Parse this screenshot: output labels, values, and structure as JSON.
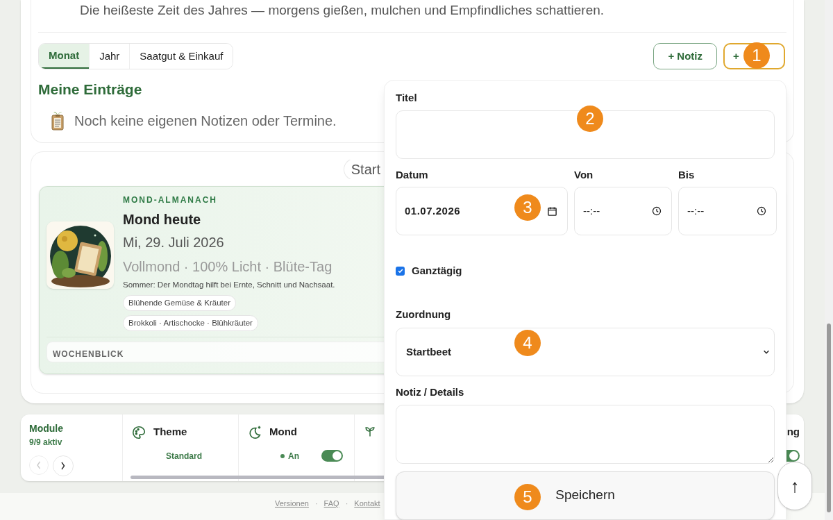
{
  "intro_text": "Die heißeste Zeit des Jahres — morgens gießen, mulchen und Empfindliches schattieren.",
  "tabs": [
    {
      "label": "Monat",
      "selected": true
    },
    {
      "label": "Jahr",
      "selected": false
    },
    {
      "label": "Saatgut & Einkauf",
      "selected": false
    }
  ],
  "action_buttons": [
    {
      "label": "+ Notiz",
      "kind": "note"
    },
    {
      "label": "+",
      "kind": "event"
    }
  ],
  "entries": {
    "heading": "Meine Einträge",
    "empty_text": "Noch keine eigenen Notizen oder Termine."
  },
  "filter_chips": [
    "Start"
  ],
  "moon_card": {
    "eyebrow": "MOND-ALMANACH",
    "title": "Mond heute",
    "date": "Mi, 29. Juli 2026",
    "phase": "Vollmond · 100% Licht · Blüte-Tag",
    "note": "Sommer: Der Mondtag hilft bei Ernte, Schnitt und Nachsaat.",
    "tags": [
      "Blühende Gemüse & Kräuter",
      "Brokkoli · Artischocke · Blühkräuter"
    ],
    "weekly_label": "WOCHENBLICK"
  },
  "modules": {
    "title": "Module",
    "count": "9/9 aktiv",
    "items": [
      {
        "title": "Theme",
        "kind": "value",
        "status": "Standard"
      },
      {
        "title": "Mond",
        "kind": "toggle",
        "status": "An",
        "on": true
      },
      {
        "kind": "covered"
      },
      {
        "title": "ng",
        "kind": "toggle",
        "on": true
      }
    ]
  },
  "footer_links": [
    "Versionen",
    "FAQ",
    "Kontakt"
  ],
  "footer_separator": "·",
  "form": {
    "title_label": "Titel",
    "date_label": "Datum",
    "date_value": "01.07.2026",
    "from_label": "Von",
    "from_value": "--:--",
    "to_label": "Bis",
    "to_value": "--:--",
    "all_day_label": "Ganztägig",
    "all_day_checked": true,
    "assign_label": "Zuordnung",
    "assign_value": "Startbeet",
    "notes_label": "Notiz / Details",
    "submit": "Speichern"
  },
  "scroll_top_button": "↑",
  "markers": [
    "1",
    "2",
    "3",
    "4",
    "5"
  ]
}
